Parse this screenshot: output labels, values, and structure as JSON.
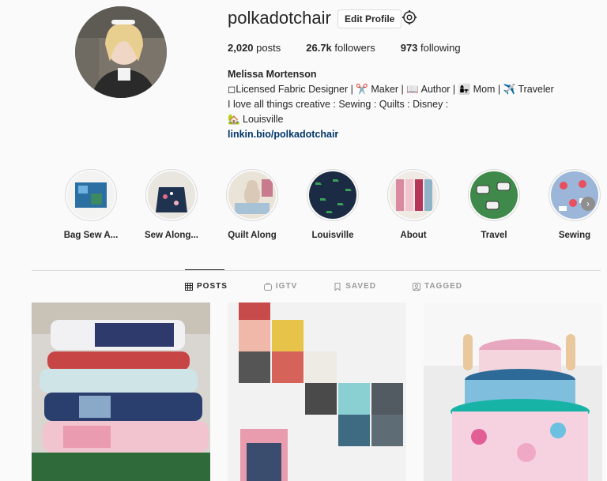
{
  "profile": {
    "username": "polkadotchair",
    "edit_label": "Edit Profile",
    "posts_count": "2,020",
    "posts_label": "posts",
    "followers_count": "26.7k",
    "followers_label": "followers",
    "following_count": "973",
    "following_label": "following"
  },
  "bio": {
    "name": "Melissa Mortenson",
    "line1": "◻Licensed Fabric Designer | ✂️ Maker | 📖 Author | 👩‍👧 Mom | ✈️ Traveler",
    "line2": "I love all things creative : Sewing : Quilts : Disney :",
    "line3": "🏡 Louisville",
    "link": "linkin.bio/polkadotchair"
  },
  "highlights": [
    {
      "label": "Bag Sew A...",
      "color": "#2b6fa3"
    },
    {
      "label": "Sew Along...",
      "color": "#1f3350"
    },
    {
      "label": "Quilt Along",
      "color": "#d9c9b6"
    },
    {
      "label": "Louisville",
      "color": "#1c2b44"
    },
    {
      "label": "About",
      "color": "#d98aa0"
    },
    {
      "label": "Travel",
      "color": "#3f8a4a"
    },
    {
      "label": "Sewing",
      "color": "#9bb6d8"
    }
  ],
  "tabs": [
    {
      "label": "POSTS",
      "icon": "grid-icon"
    },
    {
      "label": "IGTV",
      "icon": "tv-icon"
    },
    {
      "label": "SAVED",
      "icon": "bookmark-icon"
    },
    {
      "label": "TAGGED",
      "icon": "tag-icon"
    }
  ],
  "colors": {
    "link": "#003569",
    "border": "#dbdbdb",
    "background": "#fafafa"
  }
}
